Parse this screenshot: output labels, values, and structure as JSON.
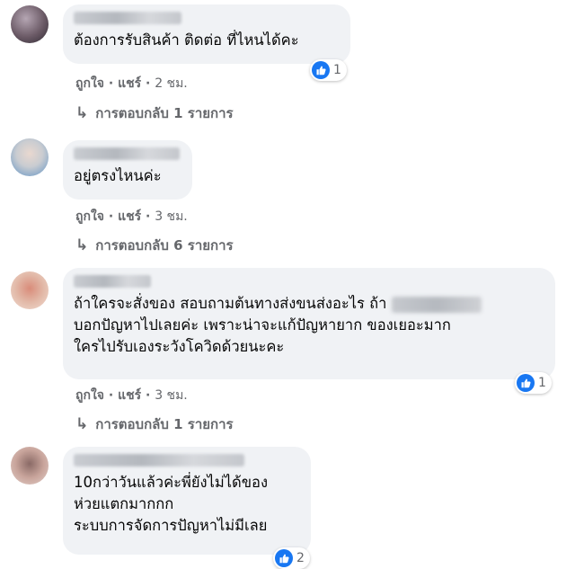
{
  "comments": [
    {
      "lines": [
        "ต้องการรับสินค้า ติดต่อ ที่ไหนได้คะ"
      ],
      "reaction_count": "1",
      "like_label": "ถูกใจ",
      "share_label": "แชร์",
      "time": "2 ชม.",
      "replies_label": "การตอบกลับ 1 รายการ",
      "avatar_colors": [
        "#b5a6b3",
        "#6b5a66",
        "#2f2a33"
      ]
    },
    {
      "lines": [
        "อยู่ตรงไหนค่ะ"
      ],
      "like_label": "ถูกใจ",
      "share_label": "แชร์",
      "time": "3 ชม.",
      "replies_label": "การตอบกลับ 6 รายการ",
      "avatar_colors": [
        "#c9ccd1",
        "#7ea3c8",
        "#d9cfc8"
      ]
    },
    {
      "lines": [
        "ถ้าใครจะสั่งของ สอบถามต้นทางส่งขนส่งอะไร ถ้า",
        "บอกปัญหาไปเลยค่ะ เพราะน่าจะแก้ปัญหายาก ของเยอะมาก",
        "ใครไปรับเองระวังโควิดด้วยนะคะ"
      ],
      "reaction_count": "1",
      "like_label": "ถูกใจ",
      "share_label": "แชร์",
      "time": "3 ชม.",
      "replies_label": "การตอบกลับ 1 รายการ",
      "avatar_colors": [
        "#e2b9a8",
        "#d98c7a",
        "#f1ddd2"
      ]
    },
    {
      "lines": [
        "10กว่าวันแล้วค่ะพี่ยังไม่ได้ของ",
        "ห่วยแตกมากกก",
        "ระบบการจัดการปัญหาไม่มีเลย"
      ],
      "reaction_count": "2",
      "avatar_colors": [
        "#c8a49b",
        "#8a6a66",
        "#e3cfc9"
      ]
    }
  ],
  "colors": {
    "bubble": "#f0f2f5",
    "meta_text": "#65676b",
    "like_blue": "#1877f2"
  }
}
